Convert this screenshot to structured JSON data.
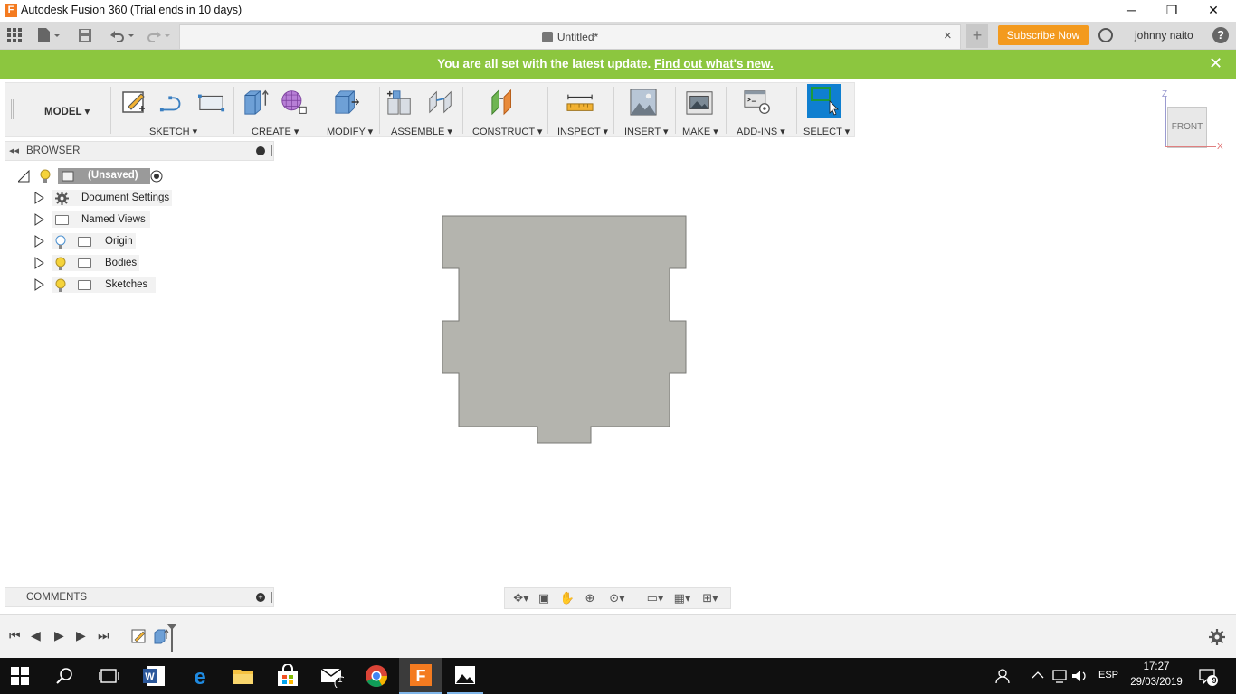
{
  "window": {
    "title": "Autodesk Fusion 360 (Trial ends in 10 days)",
    "logo_letter": "F",
    "minimize": "─",
    "restore": "❐",
    "close": "✕"
  },
  "app_toolbar": {
    "tab_title": "Untitled*",
    "tab_close": "×",
    "new_tab": "+",
    "subscribe_label": "Subscribe Now",
    "user_name": "johnny naito",
    "help": "?"
  },
  "banner": {
    "message": "You are all set with the latest update.",
    "link": "Find out what's new.",
    "close": "✕"
  },
  "ribbon": {
    "workspace": "MODEL",
    "groups": [
      "SKETCH",
      "CREATE",
      "MODIFY",
      "ASSEMBLE",
      "CONSTRUCT",
      "INSPECT",
      "INSERT",
      "MAKE",
      "ADD-INS",
      "SELECT"
    ]
  },
  "viewcube": {
    "face": "FRONT",
    "axis_z": "Z",
    "axis_x": "X"
  },
  "browser": {
    "title": "BROWSER",
    "root": "(Unsaved)",
    "items": [
      {
        "label": "Document Settings"
      },
      {
        "label": "Named Views"
      },
      {
        "label": "Origin"
      },
      {
        "label": "Bodies"
      },
      {
        "label": "Sketches"
      }
    ]
  },
  "comments": {
    "title": "COMMENTS"
  },
  "taskbar": {
    "language": "ESP",
    "time": "17:27",
    "date": "29/03/2019",
    "notification_count": "9",
    "mail_badge": "1"
  },
  "colors": {
    "banner": "#8cc63f",
    "subscribe": "#f39a1e",
    "select_active": "#0f7fd0",
    "body_fill": "#b4b4ae"
  }
}
